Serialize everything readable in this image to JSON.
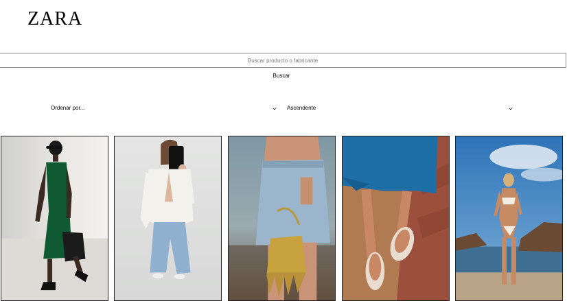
{
  "header": {
    "logo": "ZARA"
  },
  "search": {
    "placeholder": "Buscar producto o fabricante",
    "value": "",
    "button_label": "Buscar"
  },
  "filters": {
    "sort": {
      "selected": "Ordenar por..."
    },
    "order": {
      "selected": "Ascendente"
    }
  },
  "products": [
    {
      "image": "woman-green-dress-photo"
    },
    {
      "image": "woman-white-blazer-jeans-photo"
    },
    {
      "image": "denim-skirt-gold-bag-photo"
    },
    {
      "image": "flip-flops-blue-dress-photo"
    },
    {
      "image": "bikini-beach-photo"
    }
  ],
  "colors": {
    "text": "#111111",
    "border": "#8a8a8a",
    "background": "#ffffff"
  }
}
